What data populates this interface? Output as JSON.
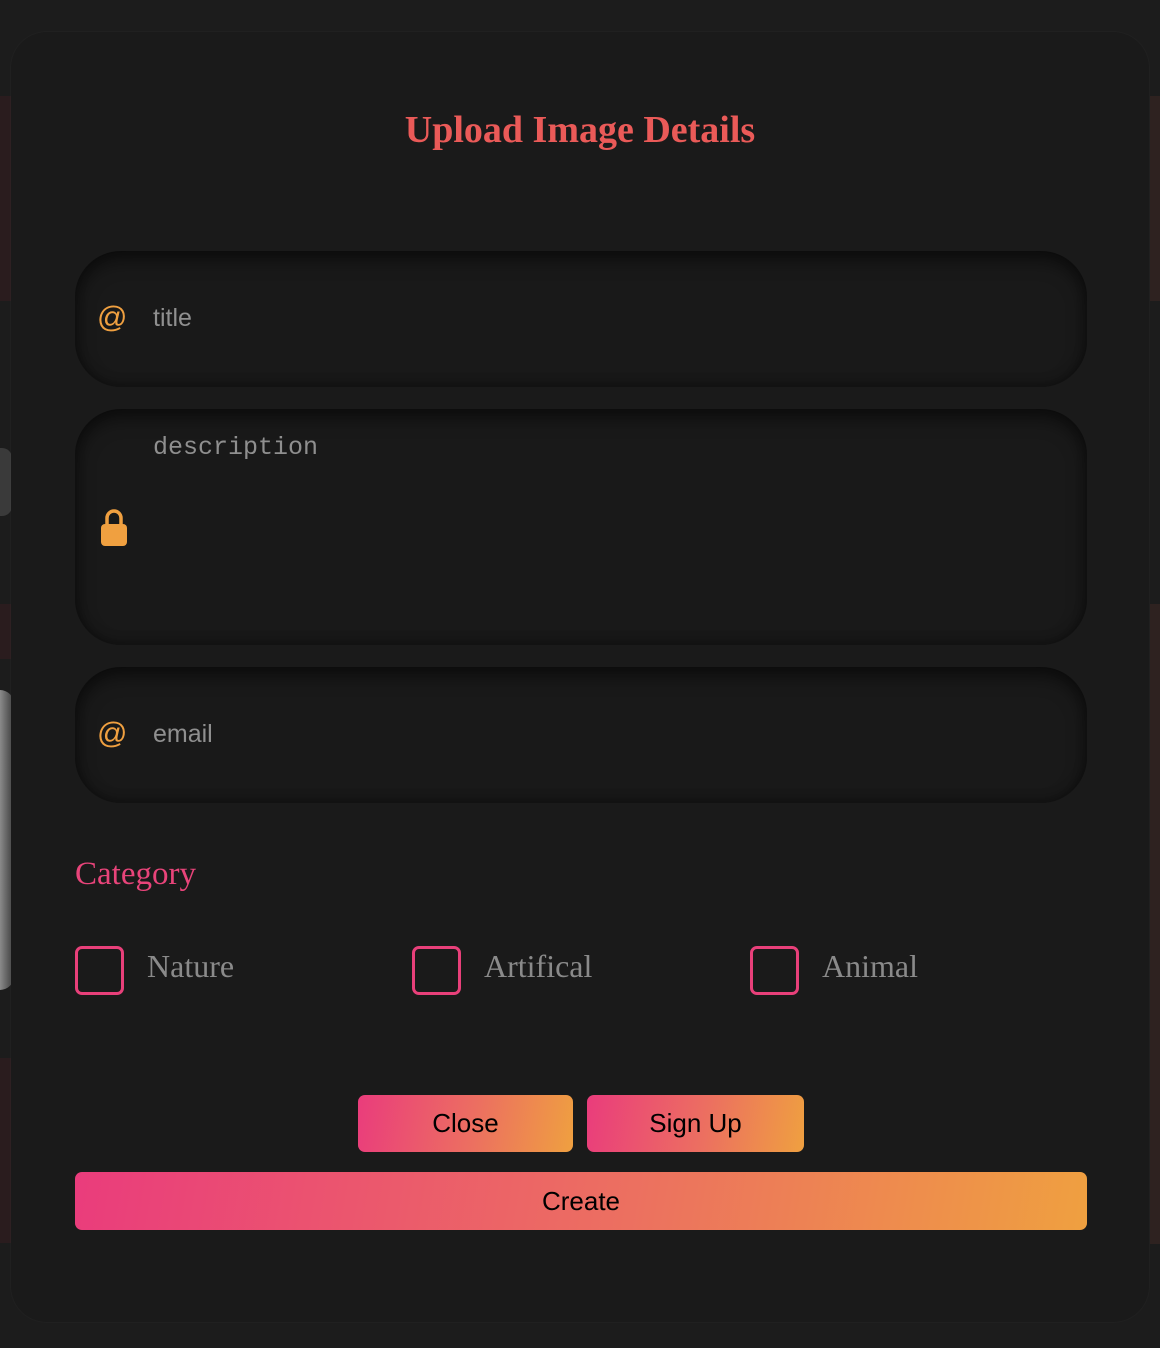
{
  "modal": {
    "title": "Upload Image Details"
  },
  "form": {
    "title_placeholder": "title",
    "description_placeholder": "description",
    "email_placeholder": "email",
    "icon_at": "@",
    "lock_icon": "lock-icon"
  },
  "category": {
    "label": "Category",
    "options": [
      "Nature",
      "Artifical",
      "Animal"
    ]
  },
  "buttons": {
    "close": "Close",
    "signup": "Sign Up",
    "create": "Create"
  },
  "colors": {
    "title": "#ea5a58",
    "category": "#e8447a",
    "icon": "#f0a040",
    "gradient_start": "#ea3c7c",
    "gradient_end": "#efa040"
  }
}
